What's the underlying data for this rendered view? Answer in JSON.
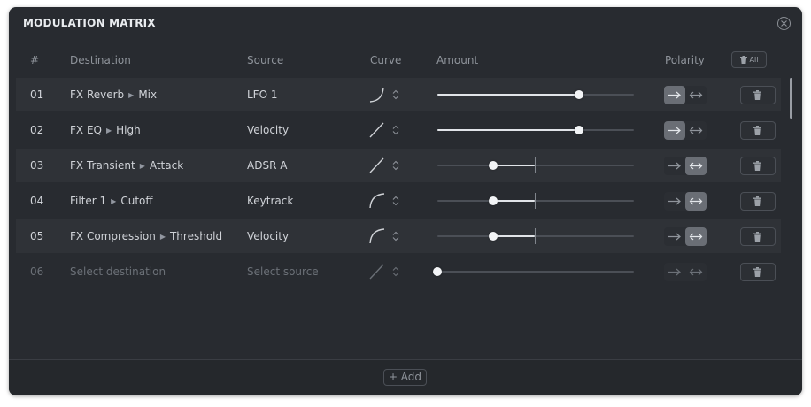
{
  "window": {
    "title": "MODULATION MATRIX"
  },
  "headers": {
    "index": "#",
    "destination": "Destination",
    "source": "Source",
    "curve": "Curve",
    "amount": "Amount",
    "polarity": "Polarity",
    "clear_all": "All"
  },
  "rows": [
    {
      "num": "01",
      "dest_parent": "FX Reverb",
      "dest_param": "Mix",
      "source": "LFO 1",
      "curve": "exp-curve-icon",
      "amount": 0.72,
      "bipolar": false,
      "polarity": "unipolar"
    },
    {
      "num": "02",
      "dest_parent": "FX EQ",
      "dest_param": "High",
      "source": "Velocity",
      "curve": "linear-curve-icon",
      "amount": 0.72,
      "bipolar": false,
      "polarity": "unipolar"
    },
    {
      "num": "03",
      "dest_parent": "FX Transient",
      "dest_param": "Attack",
      "source": "ADSR A",
      "curve": "linear-curve-icon",
      "amount": -0.43,
      "bipolar": true,
      "polarity": "bipolar"
    },
    {
      "num": "04",
      "dest_parent": "Filter 1",
      "dest_param": "Cutoff",
      "source": "Keytrack",
      "curve": "log-curve-icon",
      "amount": -0.43,
      "bipolar": true,
      "polarity": "bipolar"
    },
    {
      "num": "05",
      "dest_parent": "FX Compression",
      "dest_param": "Threshold",
      "source": "Velocity",
      "curve": "log-curve-icon",
      "amount": -0.43,
      "bipolar": true,
      "polarity": "bipolar"
    },
    {
      "num": "06",
      "dest_placeholder": "Select destination",
      "source_placeholder": "Select source",
      "curve": "linear-curve-icon",
      "amount": 0,
      "bipolar": false,
      "polarity": "none"
    }
  ],
  "footer": {
    "add_label": "+ Add"
  },
  "colors": {
    "background": "#282b30",
    "row_shaded": "#2f3237",
    "accent_fill": "#e1e4e8",
    "track": "#4b4f56"
  }
}
